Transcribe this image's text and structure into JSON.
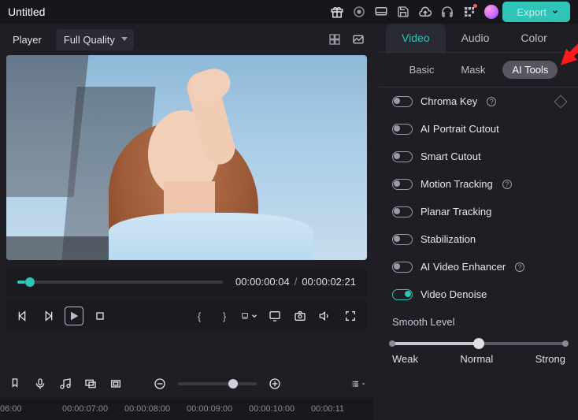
{
  "title": "Untitled",
  "export_label": "Export",
  "player": {
    "label": "Player",
    "quality": "Full Quality",
    "current_time": "00:00:00:04",
    "total_time": "00:00:02:21"
  },
  "tabs": {
    "main": [
      "Video",
      "Audio",
      "Color"
    ],
    "main_active": 0,
    "sub": [
      "Basic",
      "Mask",
      "AI Tools"
    ],
    "sub_active": 2
  },
  "ai_tools": [
    {
      "label": "Chroma Key",
      "on": false,
      "help": true,
      "diamond": true
    },
    {
      "label": "AI Portrait Cutout",
      "on": false,
      "help": false
    },
    {
      "label": "Smart Cutout",
      "on": false,
      "help": false
    },
    {
      "label": "Motion Tracking",
      "on": false,
      "help": true
    },
    {
      "label": "Planar Tracking",
      "on": false,
      "help": false
    },
    {
      "label": "Stabilization",
      "on": false,
      "help": false
    },
    {
      "label": "AI Video Enhancer",
      "on": false,
      "help": true
    },
    {
      "label": "Video Denoise",
      "on": true,
      "help": false
    }
  ],
  "smooth": {
    "title": "Smooth Level",
    "weak": "Weak",
    "normal": "Normal",
    "strong": "Strong",
    "value_pct": 50
  },
  "timeline_ticks": [
    "06:00",
    "00:00:07:00",
    "00:00:08:00",
    "00:00:09:00",
    "00:00:10:00",
    "00:00:11"
  ]
}
